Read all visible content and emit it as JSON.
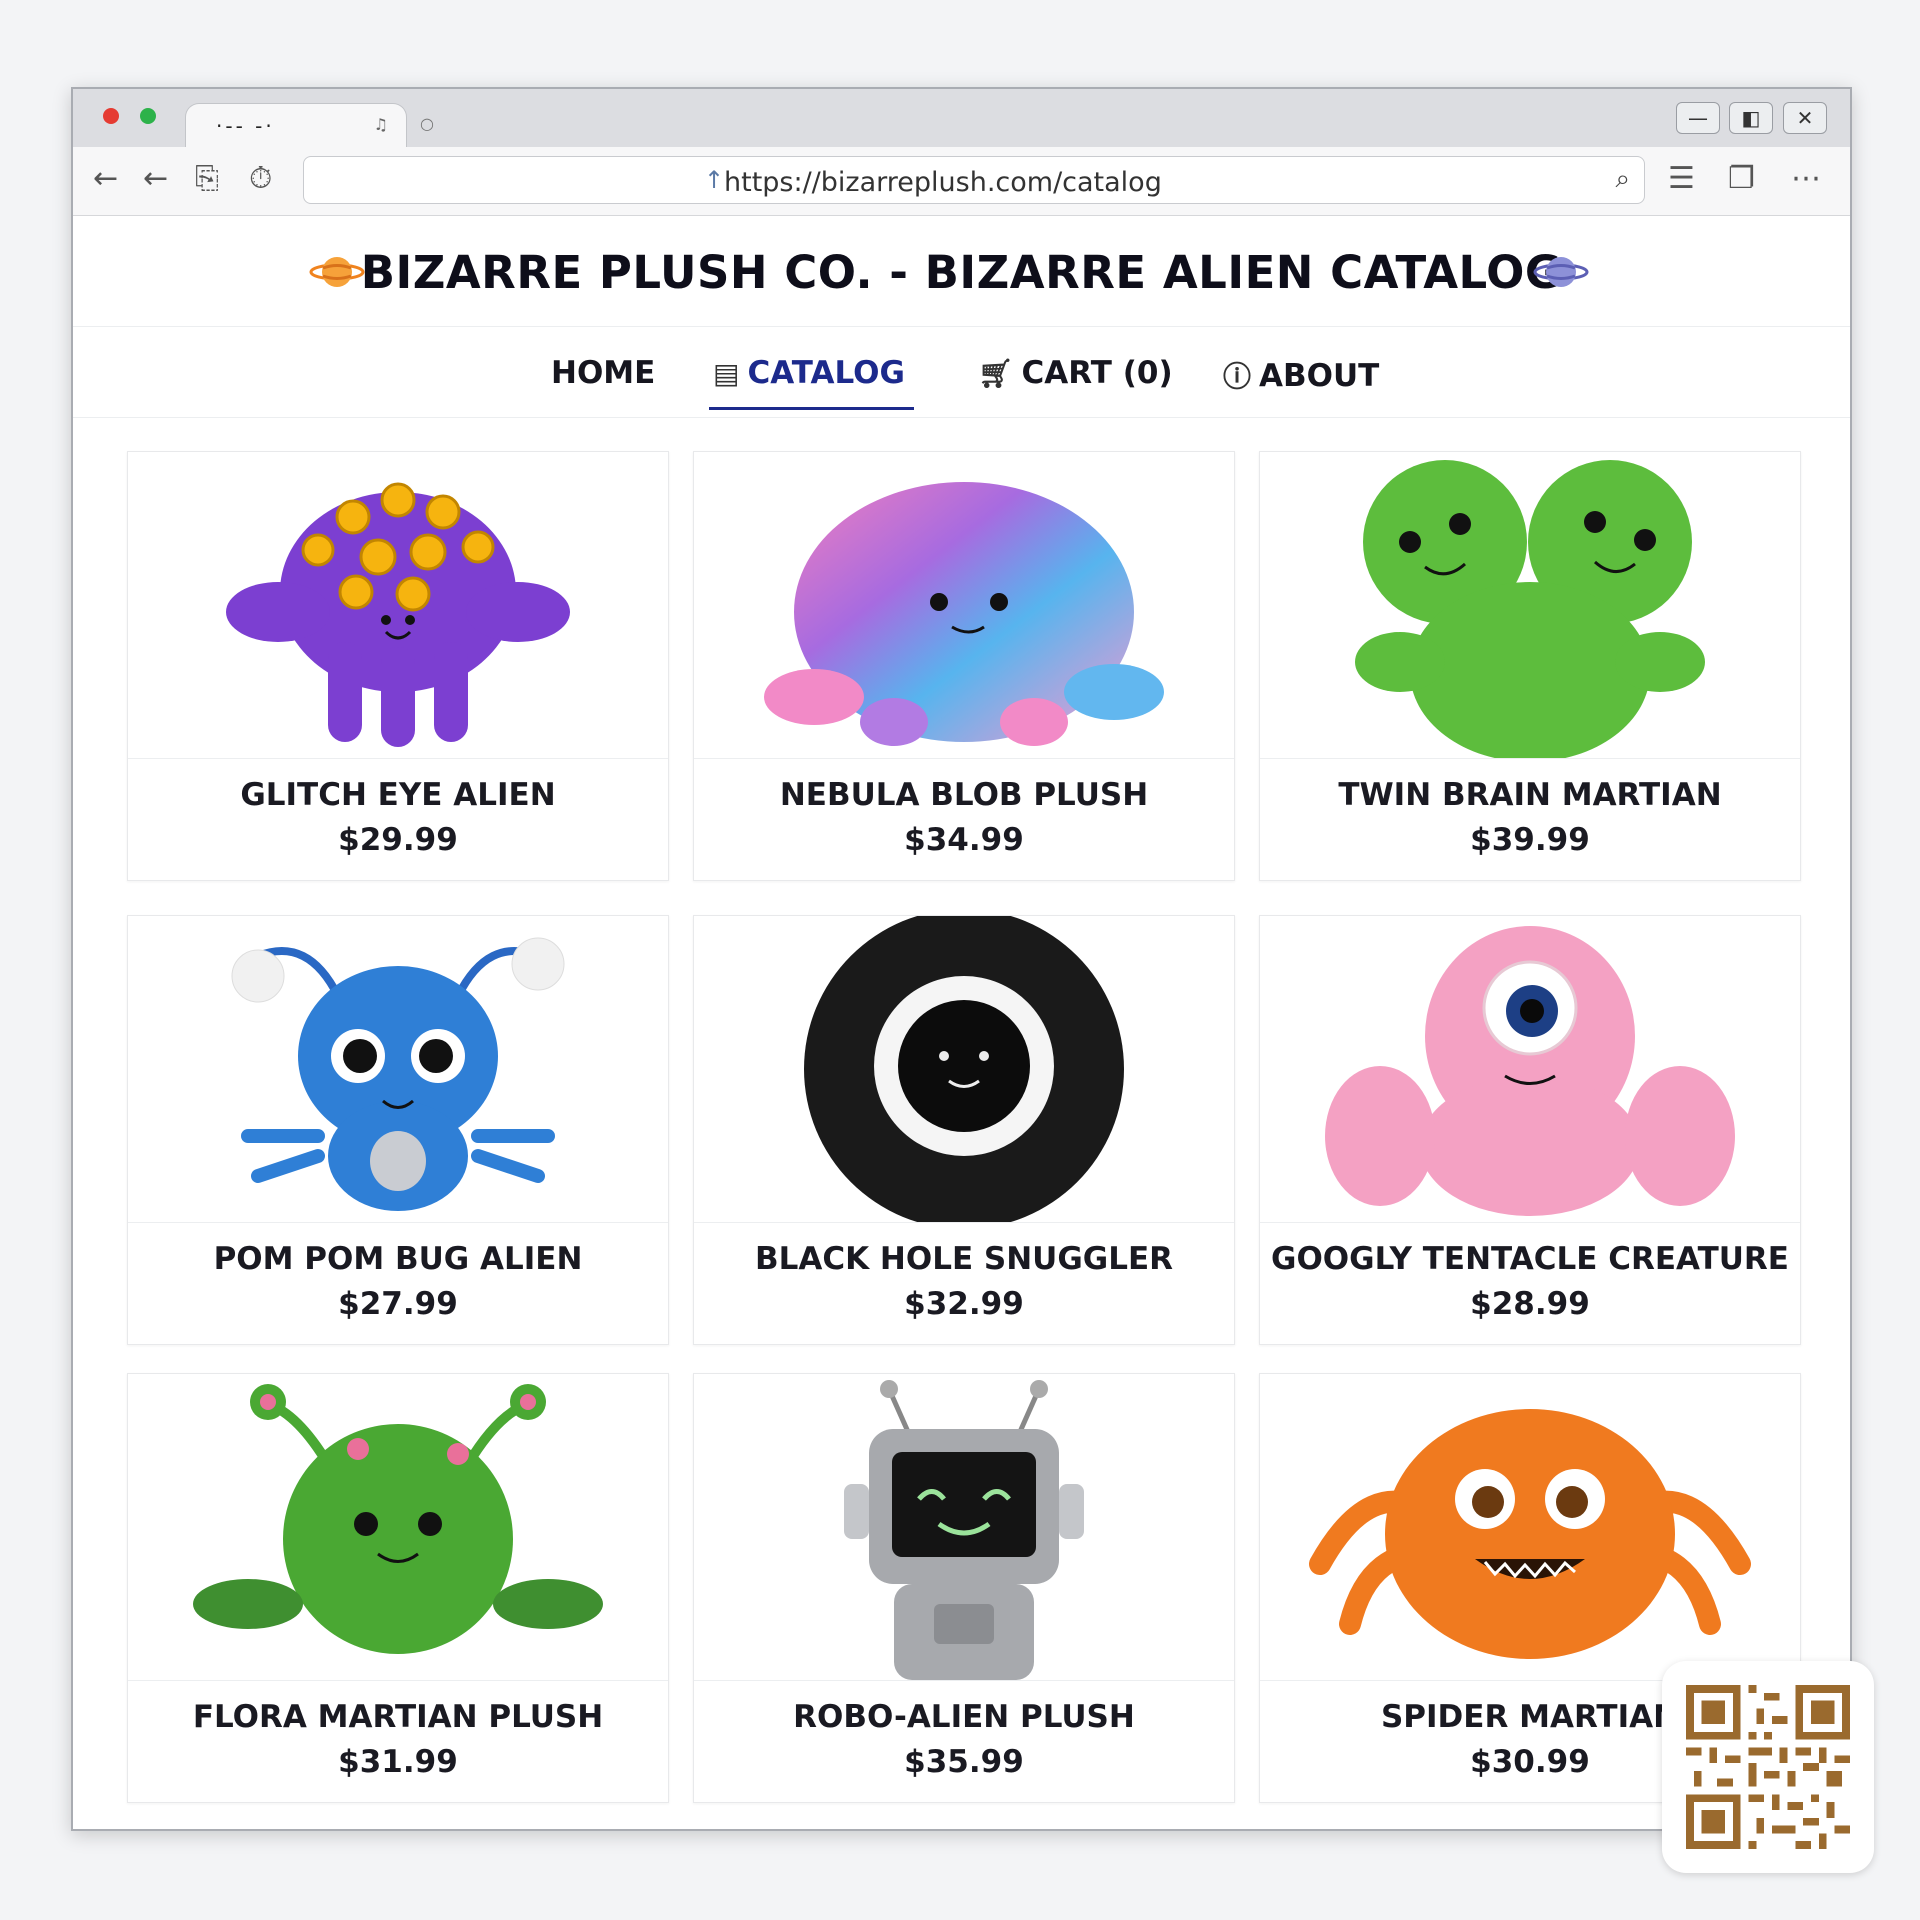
{
  "browser": {
    "tab_title": "·-- -·",
    "url": "https://bizarreplush.com/catalog"
  },
  "site": {
    "title": "BIZARRE PLUSH CO. - BIZARRE ALIEN CATALOG"
  },
  "nav": {
    "items": [
      {
        "label": "HOME",
        "icon": "",
        "active": false
      },
      {
        "label": "CATALOG",
        "icon": "catalog-icon",
        "active": true
      },
      {
        "label": "CART (0)",
        "icon": "cart-icon",
        "active": false
      },
      {
        "label": "ABOUT",
        "icon": "info-icon",
        "active": false
      }
    ]
  },
  "products": [
    {
      "name": "GLITCH EYE ALIEN",
      "price": "$29.99",
      "color": "#7c3fd1"
    },
    {
      "name": "NEBULA BLOB PLUSH",
      "price": "$34.99",
      "color": "#e77bd0"
    },
    {
      "name": "TWIN BRAIN MARTIAN",
      "price": "$39.99",
      "color": "#5dbd3d"
    },
    {
      "name": "POM POM BUG ALIEN",
      "price": "$27.99",
      "color": "#2f7fd6"
    },
    {
      "name": "BLACK HOLE SNUGGLER",
      "price": "$32.99",
      "color": "#1a1a1a"
    },
    {
      "name": "GOOGLY TENTACLE CREATURE",
      "price": "$28.99",
      "color": "#f4a1c3"
    },
    {
      "name": "FLORA MARTIAN PLUSH",
      "price": "$31.99",
      "color": "#4aa833"
    },
    {
      "name": "ROBO-ALIEN PLUSH",
      "price": "$35.99",
      "color": "#a7a9ad"
    },
    {
      "name": "SPIDER MARTIAN",
      "price": "$30.99",
      "color": "#f07a1f"
    }
  ],
  "colors": {
    "accent": "#1c2a8c",
    "qr": "#9a6a2e"
  }
}
